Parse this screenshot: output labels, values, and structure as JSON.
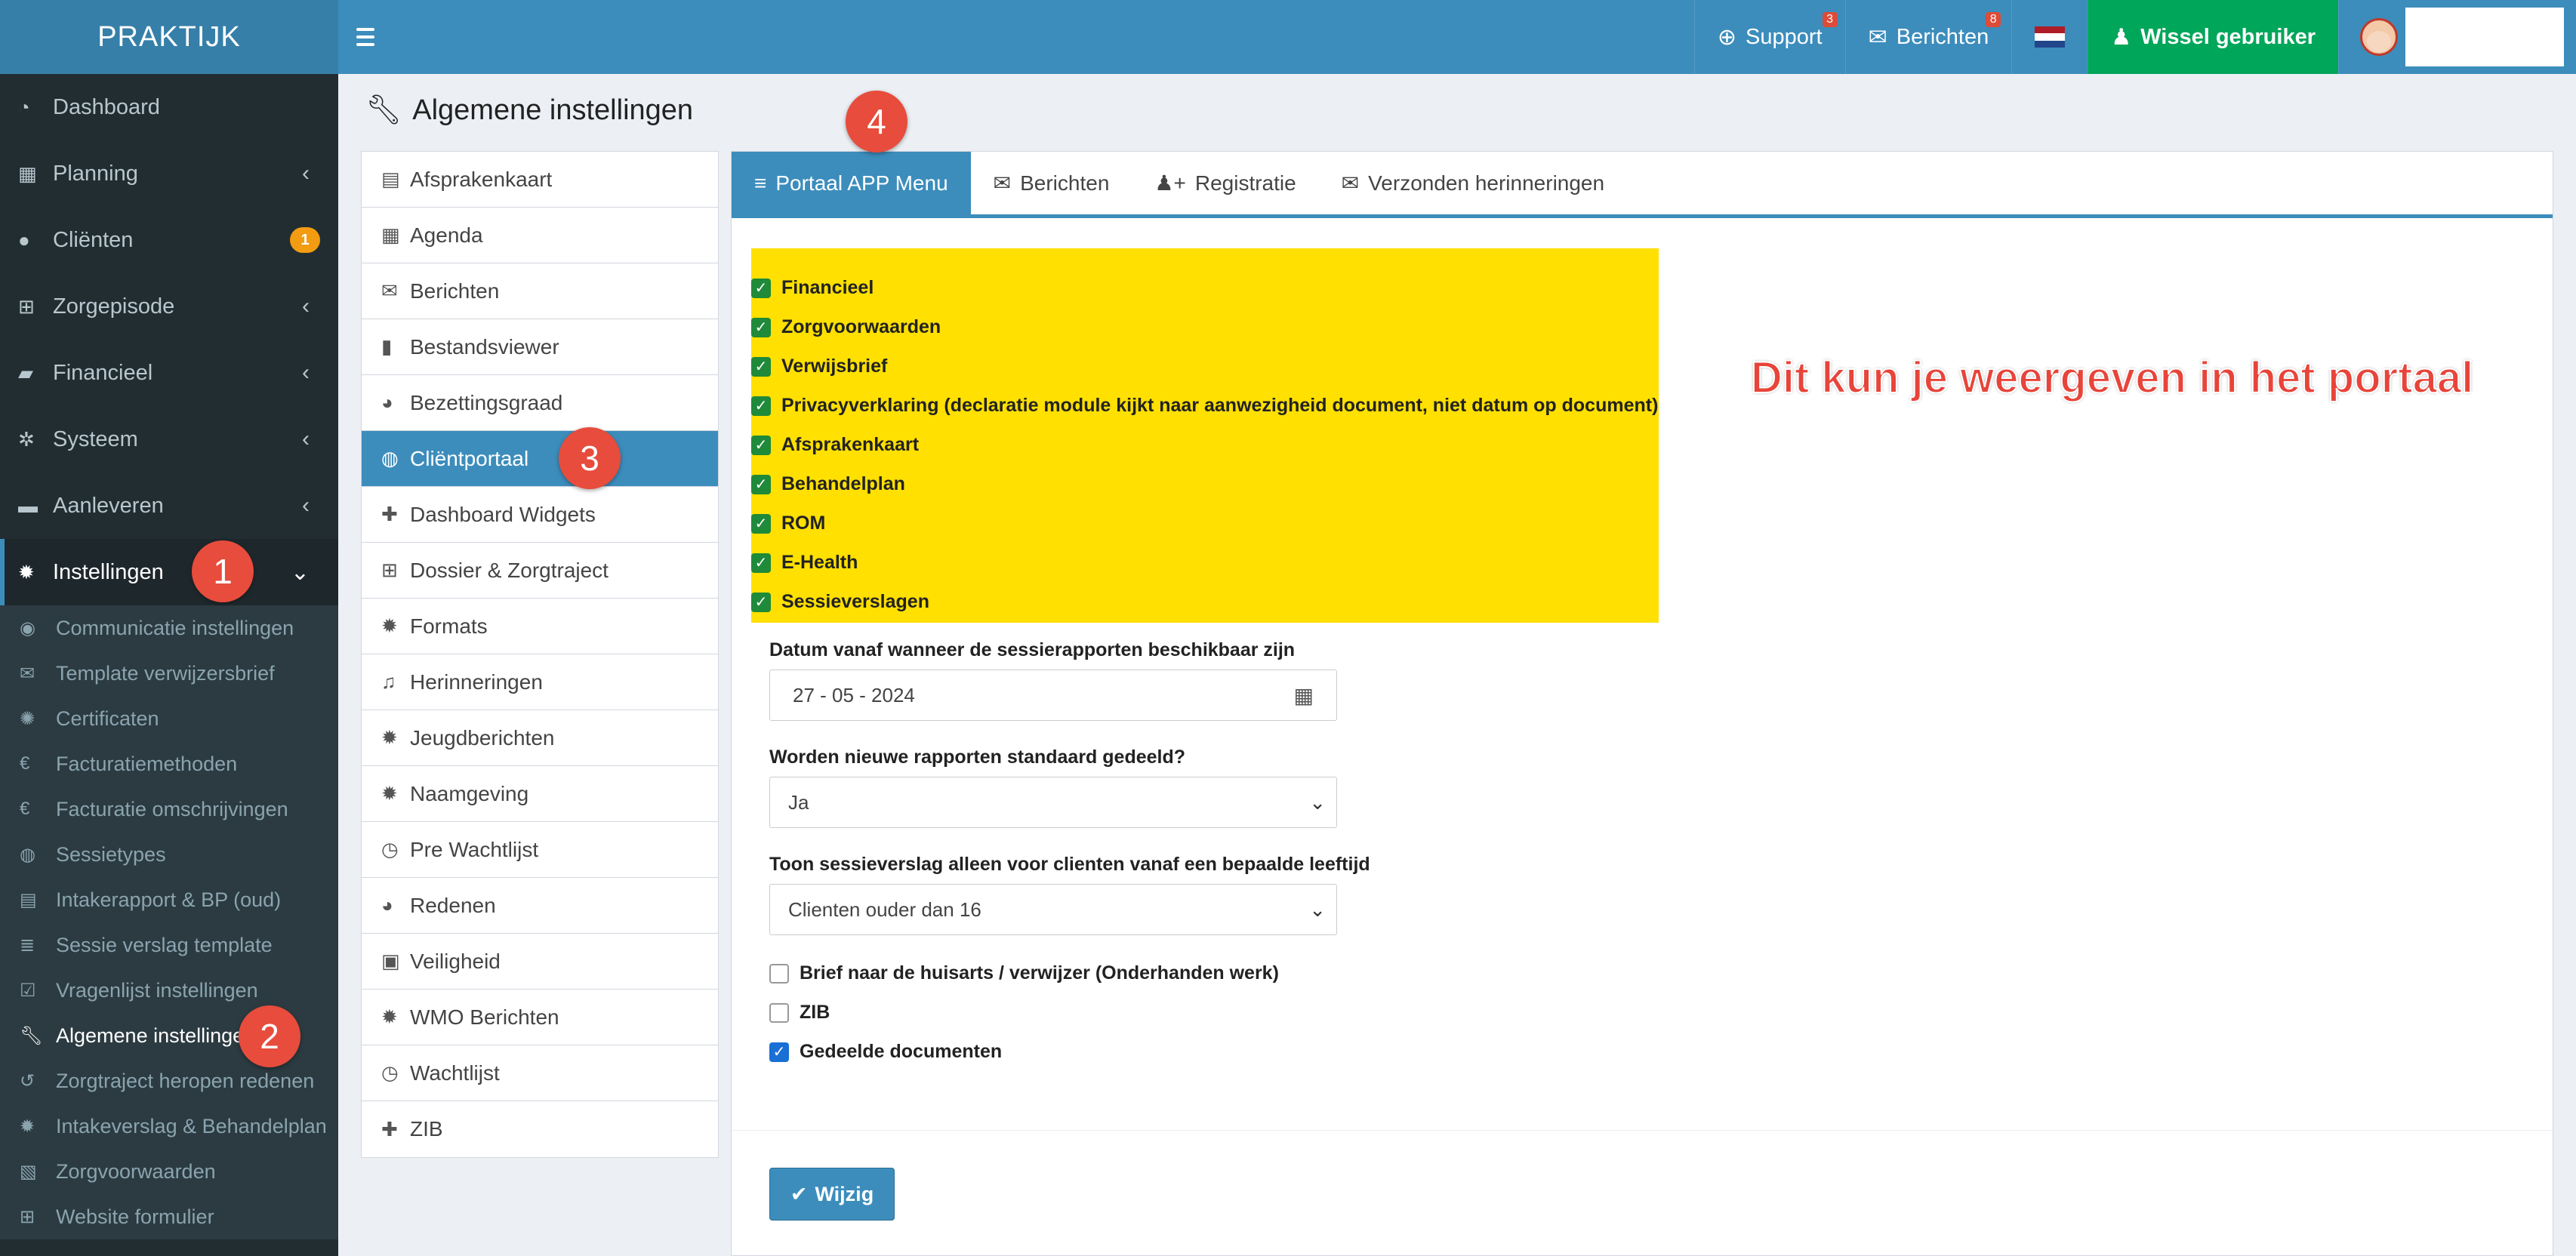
{
  "app": {
    "title": "PRAKTIJK"
  },
  "topnav": {
    "support_label": "Support",
    "support_count": "3",
    "messages_label": "Berichten",
    "messages_count": "8",
    "switch_user_label": "Wissel gebruiker"
  },
  "sidebar": {
    "items": [
      {
        "label": "Dashboard",
        "icon": "dashboard-icon"
      },
      {
        "label": "Planning",
        "icon": "calendar-icon"
      },
      {
        "label": "Cliënten",
        "icon": "user-icon",
        "badge": "1"
      },
      {
        "label": "Zorgepisode",
        "icon": "medkit-icon"
      },
      {
        "label": "Financieel",
        "icon": "book-icon"
      },
      {
        "label": "Systeem",
        "icon": "cogs-icon"
      },
      {
        "label": "Aanleveren",
        "icon": "truck-icon"
      },
      {
        "label": "Instellingen",
        "icon": "gear-icon"
      }
    ],
    "submenu": [
      {
        "label": "Communicatie instellingen",
        "icon": "comments-icon"
      },
      {
        "label": "Template verwijzersbrief",
        "icon": "envelope-icon"
      },
      {
        "label": "Certificaten",
        "icon": "certificate-icon"
      },
      {
        "label": "Facturatiemethoden",
        "icon": "euro-icon"
      },
      {
        "label": "Facturatie omschrijvingen",
        "icon": "euro-icon"
      },
      {
        "label": "Sessietypes",
        "icon": "globe-icon"
      },
      {
        "label": "Intakerapport & BP (oud)",
        "icon": "file-icon"
      },
      {
        "label": "Sessie verslag template",
        "icon": "list-icon"
      },
      {
        "label": "Vragenlijst instellingen",
        "icon": "check-square-icon"
      },
      {
        "label": "Algemene instellingen",
        "icon": "wrench-icon"
      },
      {
        "label": "Zorgtraject heropen redenen",
        "icon": "undo-icon"
      },
      {
        "label": "Intakeverslag & Behandelplan",
        "icon": "gear-icon"
      },
      {
        "label": "Zorgvoorwaarden",
        "icon": "pdf-icon"
      },
      {
        "label": "Website formulier",
        "icon": "medkit-icon"
      }
    ]
  },
  "page": {
    "title": "Algemene instellingen"
  },
  "settings_list": [
    {
      "label": "Afsprakenkaart",
      "icon": "list-alt-icon"
    },
    {
      "label": "Agenda",
      "icon": "calendar-icon"
    },
    {
      "label": "Berichten",
      "icon": "envelope-icon"
    },
    {
      "label": "Bestandsviewer",
      "icon": "file-icon"
    },
    {
      "label": "Bezettingsgraad",
      "icon": "pie-chart-icon"
    },
    {
      "label": "Cliëntportaal",
      "icon": "globe-icon"
    },
    {
      "label": "Dashboard Widgets",
      "icon": "puzzle-icon"
    },
    {
      "label": "Dossier & Zorgtraject",
      "icon": "medkit-icon"
    },
    {
      "label": "Formats",
      "icon": "gear-icon"
    },
    {
      "label": "Herinneringen",
      "icon": "bell-icon"
    },
    {
      "label": "Jeugdberichten",
      "icon": "gear-icon"
    },
    {
      "label": "Naamgeving",
      "icon": "gear-icon"
    },
    {
      "label": "Pre Wachtlijst",
      "icon": "clock-icon"
    },
    {
      "label": "Redenen",
      "icon": "pie-chart-icon"
    },
    {
      "label": "Veiligheid",
      "icon": "lock-icon"
    },
    {
      "label": "WMO Berichten",
      "icon": "gear-icon"
    },
    {
      "label": "Wachtlijst",
      "icon": "clock-icon"
    },
    {
      "label": "ZIB",
      "icon": "puzzle-icon"
    }
  ],
  "tabs": [
    {
      "label": "Portaal APP Menu",
      "icon": "bars-icon"
    },
    {
      "label": "Berichten",
      "icon": "envelope-icon"
    },
    {
      "label": "Registratie",
      "icon": "user-plus-icon"
    },
    {
      "label": "Verzonden herinneringen",
      "icon": "envelope-icon"
    }
  ],
  "portal_menu": [
    {
      "label": "Financieel",
      "checked": true
    },
    {
      "label": "Zorgvoorwaarden",
      "checked": true
    },
    {
      "label": "Verwijsbrief",
      "checked": true
    },
    {
      "label": "Privacyverklaring (declaratie module kijkt naar aanwezigheid document, niet datum op document)",
      "checked": true
    },
    {
      "label": "Afsprakenkaart",
      "checked": true
    },
    {
      "label": "Behandelplan",
      "checked": true
    },
    {
      "label": "ROM",
      "checked": true
    },
    {
      "label": "E-Health",
      "checked": true
    },
    {
      "label": "Sessieverslagen",
      "checked": true
    }
  ],
  "annotation_text": "Dit kun je weergeven in het portaal",
  "form": {
    "date_label": "Datum vanaf wanneer de sessierapporten beschikbaar zijn",
    "date_value": "27 - 05 - 2024",
    "shared_label": "Worden nieuwe rapporten standaard gedeeld?",
    "shared_value": "Ja",
    "age_label": "Toon sessieverslag alleen voor clienten vanaf een bepaalde leeftijd",
    "age_value": "Clienten ouder dan 16",
    "extra_options": [
      {
        "label": "Brief naar de huisarts / verwijzer (Onderhanden werk)",
        "checked": false
      },
      {
        "label": "ZIB",
        "checked": false
      },
      {
        "label": "Gedeelde documenten",
        "checked": true
      }
    ],
    "save_label": "Wijzig"
  },
  "markers": [
    "1",
    "2",
    "3",
    "4"
  ],
  "colors": {
    "primary": "#3c8dbc",
    "sidebar": "#222d32",
    "success": "#00a65a",
    "highlight": "#ffe000",
    "marker": "#e74c3c"
  }
}
